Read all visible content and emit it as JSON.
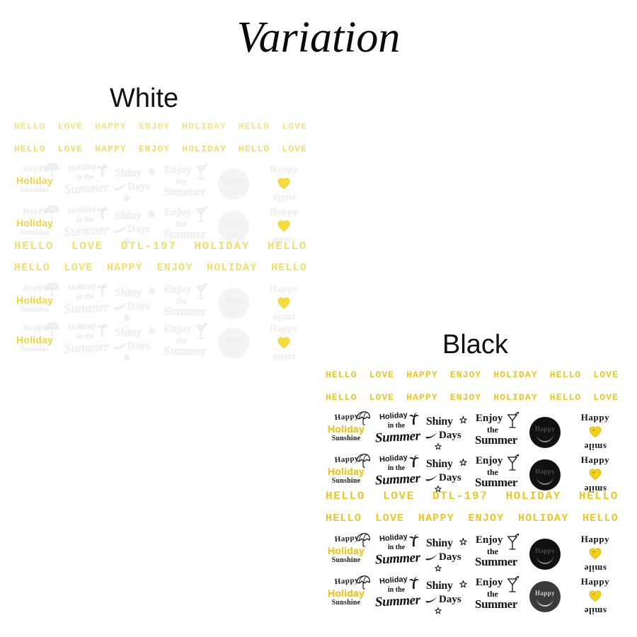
{
  "page": {
    "title": "Variation",
    "background_color": "#ffffff",
    "accent_yellow": "#e6c72c",
    "ink_black": "#111113"
  },
  "variants": [
    {
      "label": "White",
      "key": "white"
    },
    {
      "label": "Black",
      "key": "black"
    }
  ],
  "word_rows": {
    "row_a": [
      "HELLO",
      "LOVE",
      "HAPPY",
      "ENJOY",
      "HOLIDAY",
      "HELLO",
      "LOVE"
    ],
    "row_b": [
      "HELLO",
      "LOVE",
      "HAPPY",
      "ENJOY",
      "HOLIDAY",
      "HELLO",
      "LOVE"
    ],
    "row_c": [
      "HELLO",
      "LOVE",
      "DTL-197",
      "HOLIDAY",
      "HELLO"
    ],
    "row_d": [
      "HELLO",
      "LOVE",
      "HAPPY",
      "ENJOY",
      "HOLIDAY",
      "HELLO"
    ]
  },
  "product_code": "DTL-197",
  "stickers": [
    {
      "id": "happy-holiday-sunshine",
      "line1": "Happy",
      "line2": "Holiday",
      "line3": "Sunshine",
      "icon": "umbrella-icon",
      "highlight_color": "#edc92b"
    },
    {
      "id": "holiday-in-the-summer",
      "line1": "Holiday",
      "line2": "in the",
      "line3": "Summer",
      "icon": "palm-tree-icon"
    },
    {
      "id": "shiny-days",
      "line1": "Shiny",
      "line2": "Days",
      "icon": "star-icon"
    },
    {
      "id": "enjoy-the-summer",
      "line1": "Enjoy",
      "line2": "the",
      "line3": "Summer",
      "icon": "cocktail-glass-icon"
    },
    {
      "id": "happy-smiley-badge",
      "line1": "Happy",
      "icon": "smiley-face-icon",
      "badge_color": "#111113"
    },
    {
      "id": "happy-smile-heart",
      "line1": "Happy",
      "line2": "smile",
      "icon": "heart-icon",
      "heart_color": "#f2d11e"
    }
  ]
}
